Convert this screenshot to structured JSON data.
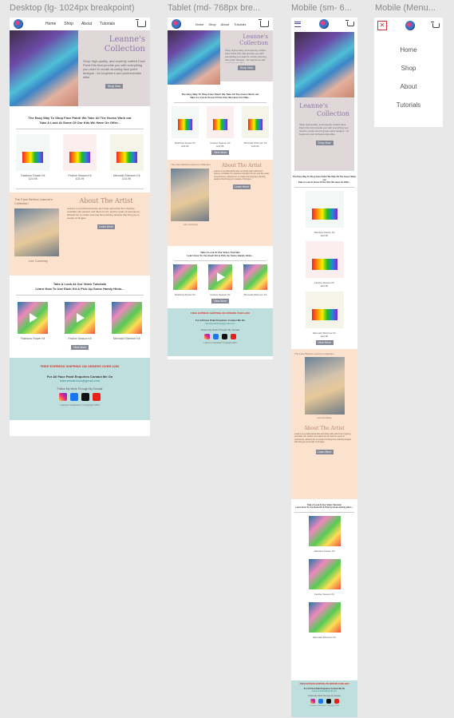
{
  "frame_labels": {
    "desktop": "Desktop (lg- 1024px breakpoint)",
    "tablet": "Tablet (md- 768px bre...",
    "mobile": "Mobile (sm- 6...",
    "mobile_menu": "Mobile (Menu..."
  },
  "nav": {
    "home": "Home",
    "shop": "Shop",
    "about": "About",
    "tutorials": "Tutorials"
  },
  "hero": {
    "title_line1": "Leanne's",
    "title_line2": "Collection",
    "text": "Shop high-quality, and expertly crafted Face Paint Kits that provide you with everything you need to create stunning face paint designs - for beginners and professionals alike.",
    "button": "Shop Now"
  },
  "intro": {
    "line1": "The Easy Way To Shop Face Paint! We Take All The Guess Work out",
    "line2": "Take A Look At Some Of Our Kits We Have On Offer..."
  },
  "products": [
    {
      "name": "Rainbow Flower Kit",
      "price": "£24.95"
    },
    {
      "name": "Festive Season Kit",
      "price": "£24.95"
    },
    {
      "name": "Mermaid Shimmer Kit",
      "price": "£24.95"
    }
  ],
  "view_more": "View More",
  "about": {
    "caption": "The Face Behind Leanne's Collection",
    "heading": "About The Artist",
    "name": "Lee Courtney",
    "text": "Leanne is a professional face and body paint artist from Sydney, Australia. Her passion and talent for art, and her years of experience, allowed her to create stunning face painting designs that bring joy to people of all ages.",
    "button": "Learn More"
  },
  "video": {
    "line1": "Take A Look At Our Video Tutorials",
    "line2": "Learn How To Use Each Kit & Pick Up Some Handy Hints..."
  },
  "videos": [
    {
      "name": "Rainbow Flower Kit"
    },
    {
      "name": "Festive Season Kit"
    },
    {
      "name": "Mermaid Shimmer Kit"
    }
  ],
  "footer": {
    "shipping": "FREE EXPRESS SHIPPING ON ORDERS OVER £200",
    "enquiries": "For All Face Paint Enquiries Contact Me On",
    "email": "leannesrainbow@gmail.com",
    "follow": "Follow My Work Through My Socials",
    "copyright": "Leanne's Collection© Copyright 2024"
  },
  "menu": {
    "home": "Home",
    "shop": "Shop",
    "about": "About",
    "tutorials": "Tutorials"
  },
  "colors": {
    "hero_bg": "#e0d7d9",
    "about_bg": "#fbe2cf",
    "footer_bg": "#bfdfde",
    "accent": "#8a7aa8"
  }
}
